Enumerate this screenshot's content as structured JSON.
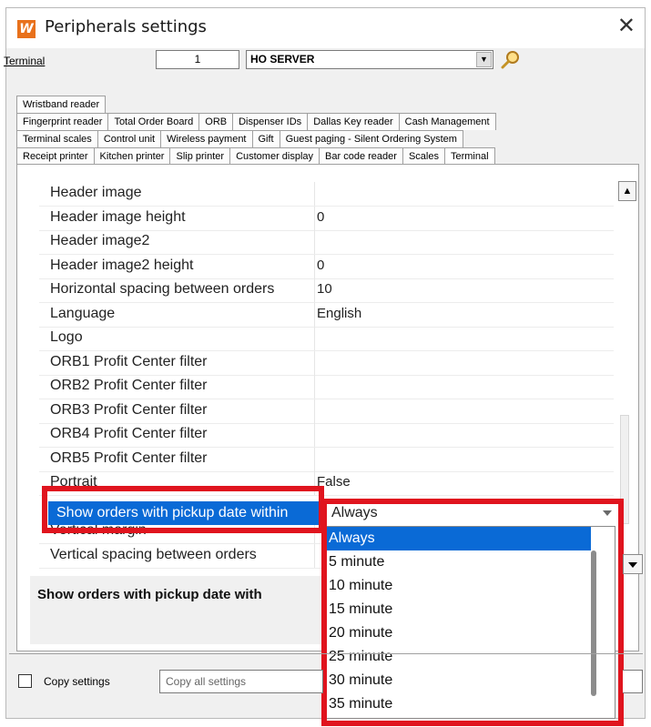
{
  "window": {
    "title": "Peripherals settings",
    "app_icon_letter": "W",
    "close_glyph": "✕"
  },
  "terminal": {
    "label": "Terminal",
    "number": "1",
    "selected": "HO SERVER",
    "dropdown_icon": "chevron-down-icon",
    "search_icon": "search-icon"
  },
  "tabs": {
    "row1": [
      "Wristband reader"
    ],
    "row2": [
      "Fingerprint reader",
      "Total Order Board",
      "ORB",
      "Dispenser IDs",
      "Dallas Key reader",
      "Cash Management"
    ],
    "row3": [
      "Terminal scales",
      "Control unit",
      "Wireless payment",
      "Gift",
      "Guest paging - Silent Ordering System"
    ],
    "row4": [
      "Receipt printer",
      "Kitchen printer",
      "Slip printer",
      "Customer display",
      "Bar code reader",
      "Scales",
      "Terminal"
    ]
  },
  "properties": [
    {
      "name": "Header image",
      "value": ""
    },
    {
      "name": "Header image height",
      "value": "0"
    },
    {
      "name": "Header image2",
      "value": ""
    },
    {
      "name": "Header image2 height",
      "value": "0"
    },
    {
      "name": "Horizontal spacing between orders",
      "value": "10"
    },
    {
      "name": "Language",
      "value": "English"
    },
    {
      "name": "Logo",
      "value": ""
    },
    {
      "name": "ORB1 Profit Center filter",
      "value": ""
    },
    {
      "name": "ORB2 Profit Center filter",
      "value": ""
    },
    {
      "name": "ORB3 Profit Center filter",
      "value": ""
    },
    {
      "name": "ORB4 Profit Center filter",
      "value": ""
    },
    {
      "name": "ORB5 Profit Center filter",
      "value": ""
    },
    {
      "name": "Portrait",
      "value": "False"
    }
  ],
  "selected_property": {
    "name": "Show orders with pickup date within",
    "value": "Always"
  },
  "after_rows": [
    {
      "name": "Vertical margin",
      "value": ""
    },
    {
      "name": "Vertical spacing between orders",
      "value": ""
    }
  ],
  "dropdown": {
    "options": [
      "Always",
      "5 minute",
      "10 minute",
      "15 minute",
      "20 minute",
      "25 minute",
      "30 minute",
      "35 minute"
    ],
    "selected": "Always"
  },
  "description": {
    "title": "Show orders with pickup date with"
  },
  "footer": {
    "copy_settings_label": "Copy settings",
    "copy_all_settings": "Copy all settings"
  },
  "colors": {
    "selection": "#0a6ad6",
    "highlight_box": "#e0141e",
    "app_icon": "#e8711c"
  }
}
